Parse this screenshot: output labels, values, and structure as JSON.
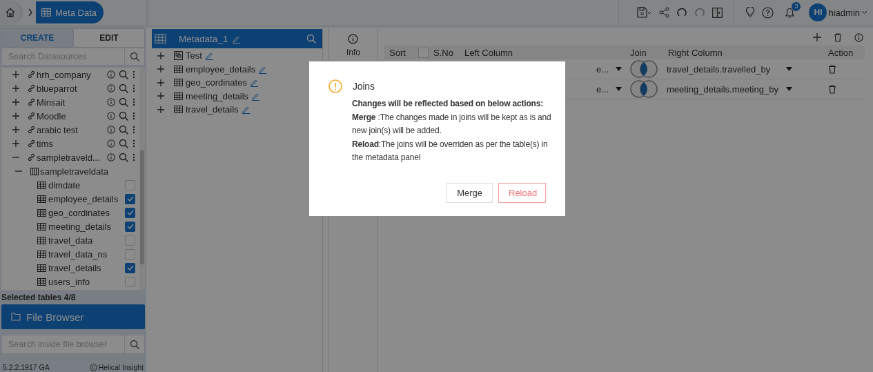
{
  "breadcrumb": {
    "current": "Meta Data"
  },
  "toolbar": {
    "notifications": "3",
    "user_initials": "HI",
    "user_name": "hiadmin"
  },
  "left_panel": {
    "tabs": [
      {
        "label": "CREATE",
        "selected": true
      },
      {
        "label": "EDIT",
        "selected": false
      }
    ],
    "search": {
      "placeholder": "Search Datasources"
    },
    "datasources": [
      {
        "name": "hrh_company",
        "expanded": false
      },
      {
        "name": "blueparrot",
        "expanded": false
      },
      {
        "name": "Minsait",
        "expanded": false
      },
      {
        "name": "Moodle",
        "expanded": false
      },
      {
        "name": "arabic test",
        "expanded": false
      },
      {
        "name": "tims",
        "expanded": false
      },
      {
        "name": "sampletraveld...",
        "expanded": true,
        "children": [
          {
            "name": "sampletraveldata",
            "expanded": true,
            "children": [
              {
                "name": "dimdate",
                "checked": false
              },
              {
                "name": "employee_details",
                "checked": true
              },
              {
                "name": "geo_cordinates",
                "checked": true
              },
              {
                "name": "meeting_details",
                "checked": true
              },
              {
                "name": "travel_data",
                "checked": false
              },
              {
                "name": "travel_data_ns",
                "checked": false
              },
              {
                "name": "travel_details",
                "checked": true
              },
              {
                "name": "users_info",
                "checked": false
              }
            ]
          }
        ]
      }
    ],
    "selected_count": "Selected tables 4/8",
    "file_browser": "File Browser",
    "file_search": {
      "placeholder": "Search inside file browser"
    },
    "version": "5.2.2.1917 GA",
    "copyright": "Helical Insight"
  },
  "metadata_panel": {
    "title": "Metadata_1",
    "items": [
      {
        "name": "Test",
        "kind": "view"
      },
      {
        "name": "employee_details",
        "kind": "table"
      },
      {
        "name": "geo_cordinates",
        "kind": "table"
      },
      {
        "name": "meeting_details",
        "kind": "table"
      },
      {
        "name": "travel_details",
        "kind": "table"
      }
    ]
  },
  "info": {
    "label": "Info"
  },
  "joins_table": {
    "columns": [
      "Sort",
      "S.No",
      "Left Column",
      "Join",
      "Right Column",
      "Action"
    ],
    "select_all_checked": false,
    "rows": [
      {
        "left": "e...",
        "right": "travel_details.travelled_by"
      },
      {
        "left": "e...",
        "right": "meeting_details.meeting_by"
      }
    ]
  },
  "dialog": {
    "title": "Joins",
    "heading": "Changes will be reflected based on below actions:",
    "lines": [
      "**Merge** :The changes made in joins will be kept as is and new join(s) will be added.",
      "**Reload**:The joins will be overriden as per the table(s) in the metadata panel"
    ],
    "buttons": [
      {
        "label": "Merge",
        "kind": "default"
      },
      {
        "label": "Reload",
        "kind": "danger"
      }
    ]
  }
}
